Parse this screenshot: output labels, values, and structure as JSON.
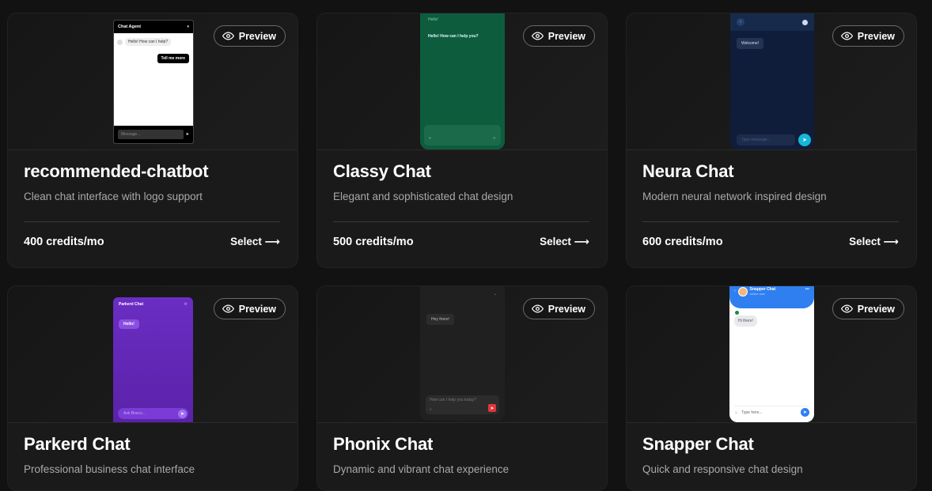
{
  "preview_label": "Preview",
  "select_label": "Select ⟶",
  "cards": [
    {
      "title": "recommended-chatbot",
      "desc": "Clean chat interface with logo support",
      "price": "400 credits/mo",
      "mock": {
        "header": "Chat Agent",
        "bot_msg": "Hello! How can I help?",
        "user_msg": "Tell me more",
        "placeholder": "Message..."
      }
    },
    {
      "title": "Classy Chat",
      "desc": "Elegant and sophisticated chat design",
      "price": "500 credits/mo",
      "mock": {
        "header": "Hello!",
        "bot_msg": "Hello! How can I help you?"
      }
    },
    {
      "title": "Neura Chat",
      "desc": "Modern neural network inspired design",
      "price": "600 credits/mo",
      "mock": {
        "bot_msg": "Welcome!",
        "placeholder": "Type message..."
      }
    },
    {
      "title": "Parkerd Chat",
      "desc": "Professional business chat interface",
      "price": "",
      "mock": {
        "header": "Parkerd Chat",
        "bot_msg": "Hello!",
        "placeholder": "Ask Bosco..."
      }
    },
    {
      "title": "Phonix Chat",
      "desc": "Dynamic and vibrant chat experience",
      "price": "",
      "mock": {
        "bot_msg": "Hey there!",
        "placeholder": "How can I help you today?"
      }
    },
    {
      "title": "Snapper Chat",
      "desc": "Quick and responsive chat design",
      "price": "",
      "mock": {
        "header": "Snapper Chat",
        "sub": "online now",
        "bot_msg": "Hi there!",
        "placeholder": "Type here..."
      }
    }
  ],
  "colors": {
    "classy": "#0e5c3e",
    "neura": "#0f1d3a",
    "neura_accent": "#17b6d8",
    "parkerd": "#6a2bc0",
    "phonix_accent": "#e0353b",
    "snapper": "#2f7ff0"
  }
}
